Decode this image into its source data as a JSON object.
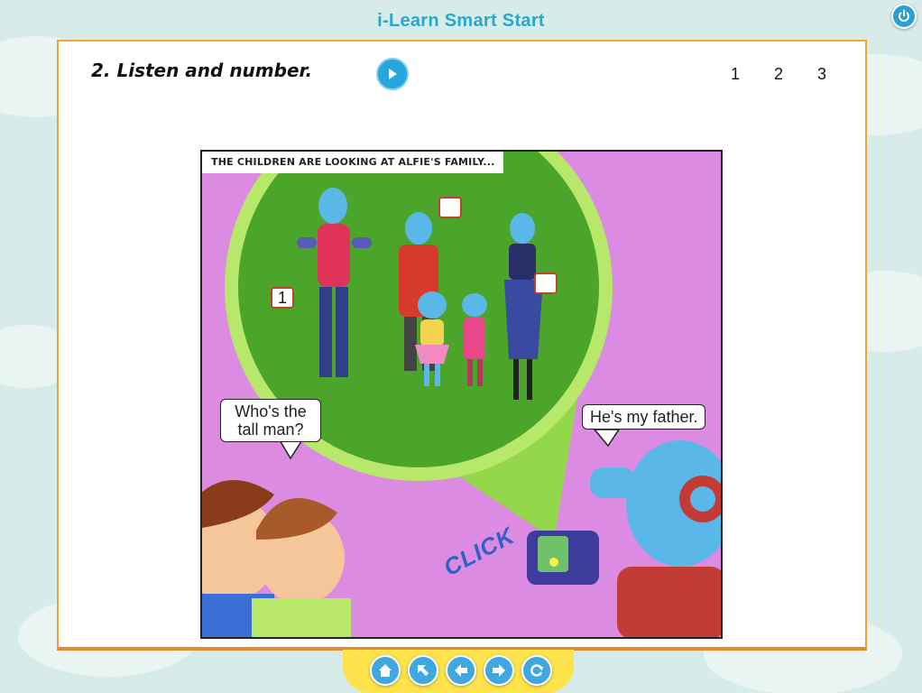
{
  "app": {
    "title": "i-Learn Smart Start"
  },
  "exercise": {
    "instruction": "2. Listen and number.",
    "pages": [
      "1",
      "2",
      "3"
    ]
  },
  "comic": {
    "caption": "THE CHILDREN ARE LOOKING AT ALFIE'S FAMILY...",
    "answer_boxes": [
      "1",
      "",
      ""
    ],
    "bubble_left": "Who's the tall man?",
    "bubble_right": "He's my father.",
    "sound_effect": "CLICK"
  },
  "nav": {
    "buttons": [
      "home-icon",
      "arrow-up-left-icon",
      "arrow-left-icon",
      "arrow-right-icon",
      "refresh-icon"
    ]
  },
  "colors": {
    "accent": "#2aa8cc",
    "panel_border": "#f1a23b",
    "nav_bar": "#fde34c"
  }
}
